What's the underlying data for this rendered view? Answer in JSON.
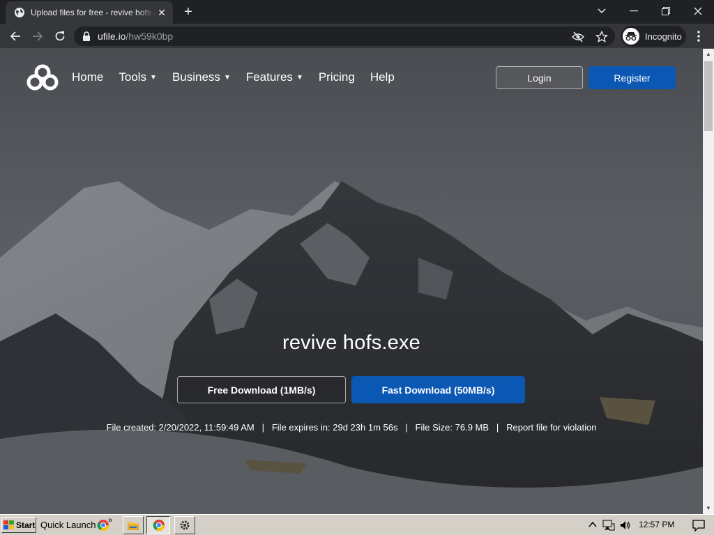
{
  "browser": {
    "tab_title": "Upload files for free - revive hofs.exe",
    "tab_close": "✕",
    "new_tab": "+",
    "url_host": "ufile.io",
    "url_path": "/hw59k0bp",
    "incognito_label": "Incognito"
  },
  "site": {
    "nav": {
      "home": "Home",
      "tools": "Tools",
      "business": "Business",
      "features": "Features",
      "pricing": "Pricing",
      "help": "Help",
      "caret": "⌄"
    },
    "login_label": "Login",
    "register_label": "Register",
    "file_name": "revive hofs.exe",
    "free_download_label": "Free Download (1MB/s)",
    "fast_download_label": "Fast Download (50MB/s)",
    "file_info": {
      "created": "File created: 2/20/2022, 11:59:49 AM",
      "expires": "File expires in: 29d 23h 1m 56s",
      "size": "File Size: 76.9 MB",
      "report": "Report file for violation",
      "separator": "   |   "
    },
    "colors": {
      "primary": "#0b58b4"
    }
  },
  "taskbar": {
    "start_label": "Start",
    "quick_launch_label": "Quick Launch",
    "chevron": "»",
    "clock": "12:57 PM"
  }
}
